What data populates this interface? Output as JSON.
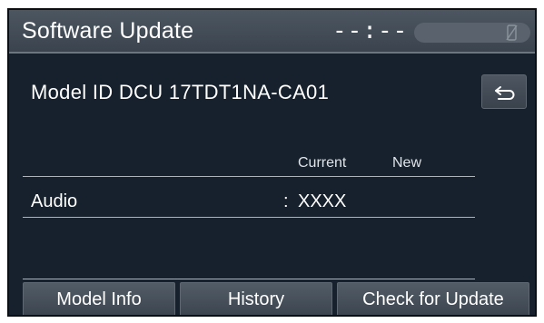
{
  "header": {
    "title": "Software Update",
    "clock": "--:--",
    "status_icon": "phone-disabled-icon"
  },
  "model": {
    "label": "Model ID DCU  17TDT1NA-CA01"
  },
  "back_button": {
    "icon": "back-arrow-icon"
  },
  "table": {
    "columns": {
      "current": "Current",
      "new": "New"
    },
    "rows": [
      {
        "label": "Audio",
        "separator": ":",
        "current": "XXXX",
        "new": ""
      }
    ]
  },
  "buttons": {
    "model_info": "Model Info",
    "history": "History",
    "check_update": "Check for Update"
  },
  "colors": {
    "background": "#16212d",
    "title_bar": "#454e58",
    "button": "#48515b",
    "text": "#ffffff"
  }
}
